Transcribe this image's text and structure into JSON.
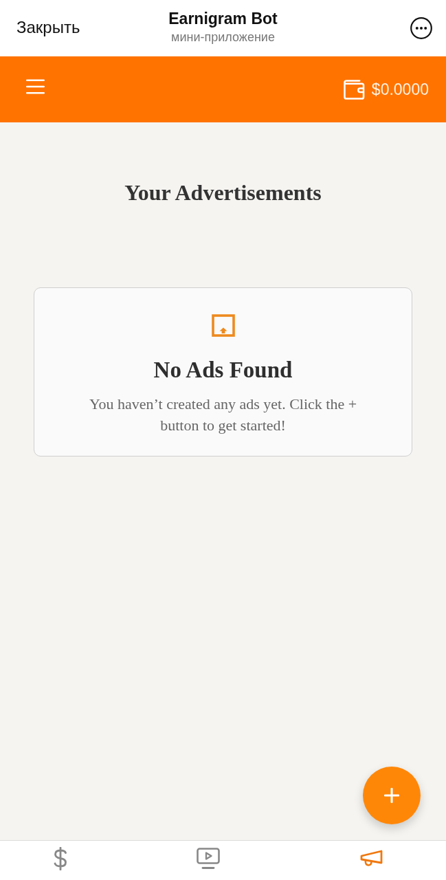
{
  "top_bar": {
    "close_label": "Закрыть",
    "title": "Earnigram Bot",
    "subtitle": "мини-приложение"
  },
  "header": {
    "balance": "$0.0000"
  },
  "page": {
    "title": "Your Advertisements"
  },
  "empty_state": {
    "title": "No Ads Found",
    "message": "You haven’t created any ads yet. Click the + button to get started!"
  },
  "bottom_nav": [
    {
      "selected": false
    },
    {
      "selected": false
    },
    {
      "selected": true
    }
  ]
}
